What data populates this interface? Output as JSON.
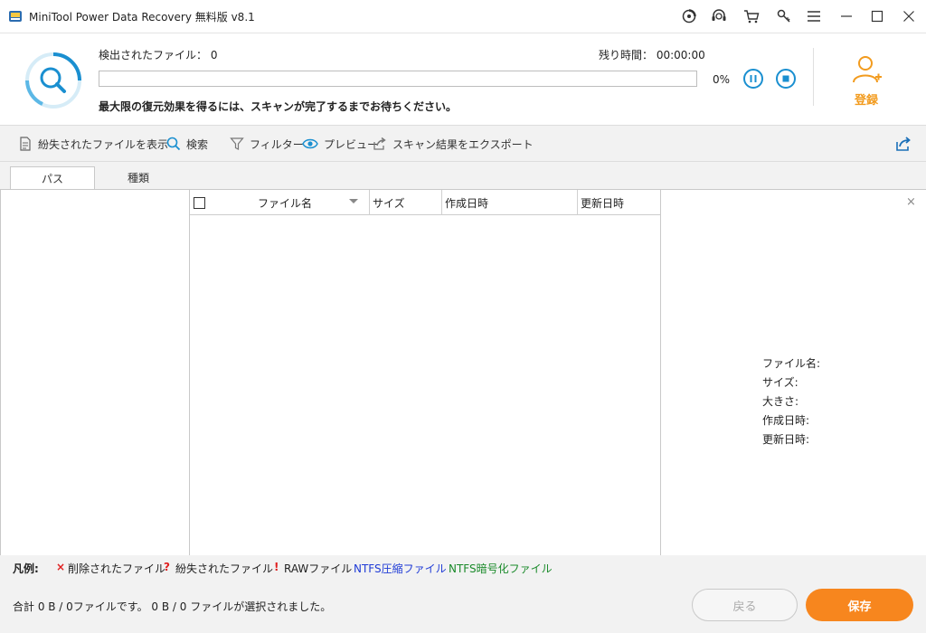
{
  "window": {
    "title": "MiniTool Power Data Recovery 無料版 v8.1",
    "title_icons": [
      "disc-icon",
      "headset-icon",
      "cart-icon",
      "key-icon",
      "menu-icon",
      "minimize-icon",
      "maximize-icon",
      "close-icon"
    ]
  },
  "scan": {
    "found_label": "検出されたファイル： 0",
    "remaining_label": "残り時間： 00:00:00",
    "progress_fraction": 0,
    "progress_text": "0%",
    "hint": "最大限の復元効果を得るには、スキャンが完了するまでお待ちください。",
    "register_label": "登録"
  },
  "toolbar": {
    "show_lost": "紛失されたファイルを表示",
    "search": "検索",
    "filter": "フィルター",
    "preview": "プレビュー",
    "export": "スキャン結果をエクスポート"
  },
  "tabs": {
    "path": "パス",
    "type": "種類"
  },
  "table": {
    "columns": [
      "ファイル名",
      "サイズ",
      "作成日時",
      "更新日時"
    ],
    "rows": []
  },
  "preview": {
    "close": "×",
    "labels": [
      "ファイル名:",
      "サイズ:",
      "大きさ:",
      "作成日時:",
      "更新日時:"
    ]
  },
  "legend": {
    "title": "凡例:",
    "deleted_mark": "×",
    "deleted": "削除されたファイル",
    "lost_mark": "?",
    "lost": "紛失されたファイル",
    "raw_mark": "!",
    "raw": "RAWファイル",
    "ntfs_compressed": "NTFS圧縮ファイル",
    "ntfs_encrypted": "NTFS暗号化ファイル"
  },
  "footer": {
    "summary": "合計 0 B / 0ファイルです。 0 B / 0 ファイルが選択されました。",
    "back": "戻る",
    "save": "保存"
  },
  "colors": {
    "accent": "#1a8fd0",
    "save": "#f7861e",
    "register": "#f29b1e",
    "deleted": "#e02020",
    "ntfs_compressed": "#1f3bd6",
    "ntfs_encrypted": "#1a8a2a"
  }
}
